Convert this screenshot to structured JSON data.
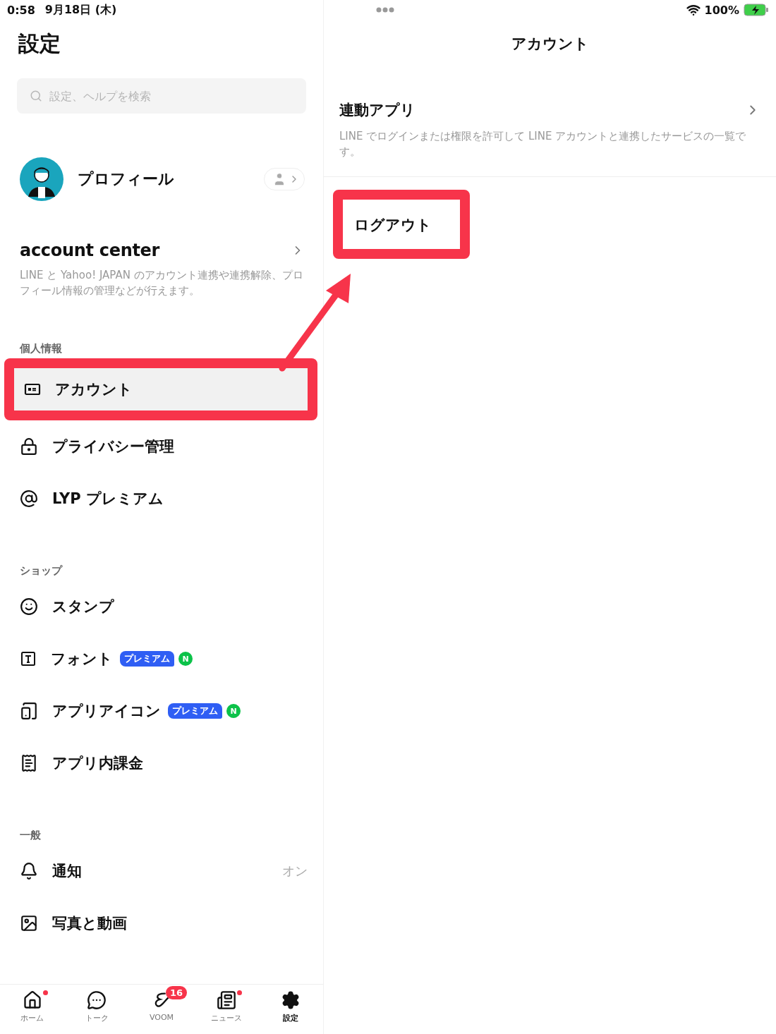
{
  "status_bar": {
    "time": "0:58",
    "date": "9月18日 (木)",
    "battery": "100%"
  },
  "sidebar": {
    "title": "設定",
    "search": {
      "placeholder": "設定、ヘルプを検索"
    },
    "profile": {
      "name": "プロフィール"
    },
    "account_center": {
      "title": "account center",
      "description": "LINE と Yahoo! JAPAN のアカウント連携や連携解除、プロフィール情報の管理などが行えます。"
    },
    "sections": [
      {
        "heading": "個人情報",
        "items": [
          {
            "label": "アカウント",
            "selected": true,
            "highlighted": true
          },
          {
            "label": "プライバシー管理",
            "selected": false,
            "highlighted": false
          },
          {
            "label": "LYP プレミアム",
            "selected": false,
            "highlighted": false
          }
        ]
      },
      {
        "heading": "ショップ",
        "items": [
          {
            "label": "スタンプ",
            "selected": false,
            "highlighted": false
          },
          {
            "label": "フォント",
            "selected": false,
            "highlighted": false,
            "badges": [
              {
                "kind": "premium",
                "text": "プレミアム"
              },
              {
                "kind": "new",
                "text": "N"
              }
            ]
          },
          {
            "label": "アプリアイコン",
            "selected": false,
            "highlighted": false,
            "badges": [
              {
                "kind": "premium",
                "text": "プレミアム"
              },
              {
                "kind": "new",
                "text": "N"
              }
            ]
          },
          {
            "label": "アプリ内課金",
            "selected": false,
            "highlighted": false
          }
        ]
      },
      {
        "heading": "一般",
        "items": [
          {
            "label": "通知",
            "selected": false,
            "highlighted": false,
            "value": "オン"
          },
          {
            "label": "写真と動画",
            "selected": false,
            "highlighted": false
          }
        ]
      }
    ]
  },
  "tab_bar": [
    {
      "label": "ホーム",
      "selected": false,
      "dot": true
    },
    {
      "label": "トーク",
      "selected": false,
      "dot": false
    },
    {
      "label": "VOOM",
      "selected": false,
      "dot": false,
      "badge": "16"
    },
    {
      "label": "ニュース",
      "selected": false,
      "dot": true
    },
    {
      "label": "設定",
      "selected": true,
      "dot": false
    }
  ],
  "detail": {
    "title": "アカウント",
    "items": [
      {
        "title": "連動アプリ",
        "description": "LINE でログインまたは権限を許可して LINE アカウントと連携したサービスの一覧です。",
        "chevron": true,
        "highlighted": false
      },
      {
        "title": "ログアウト",
        "chevron": false,
        "highlighted": true
      }
    ]
  },
  "annotation_arrow": true
}
